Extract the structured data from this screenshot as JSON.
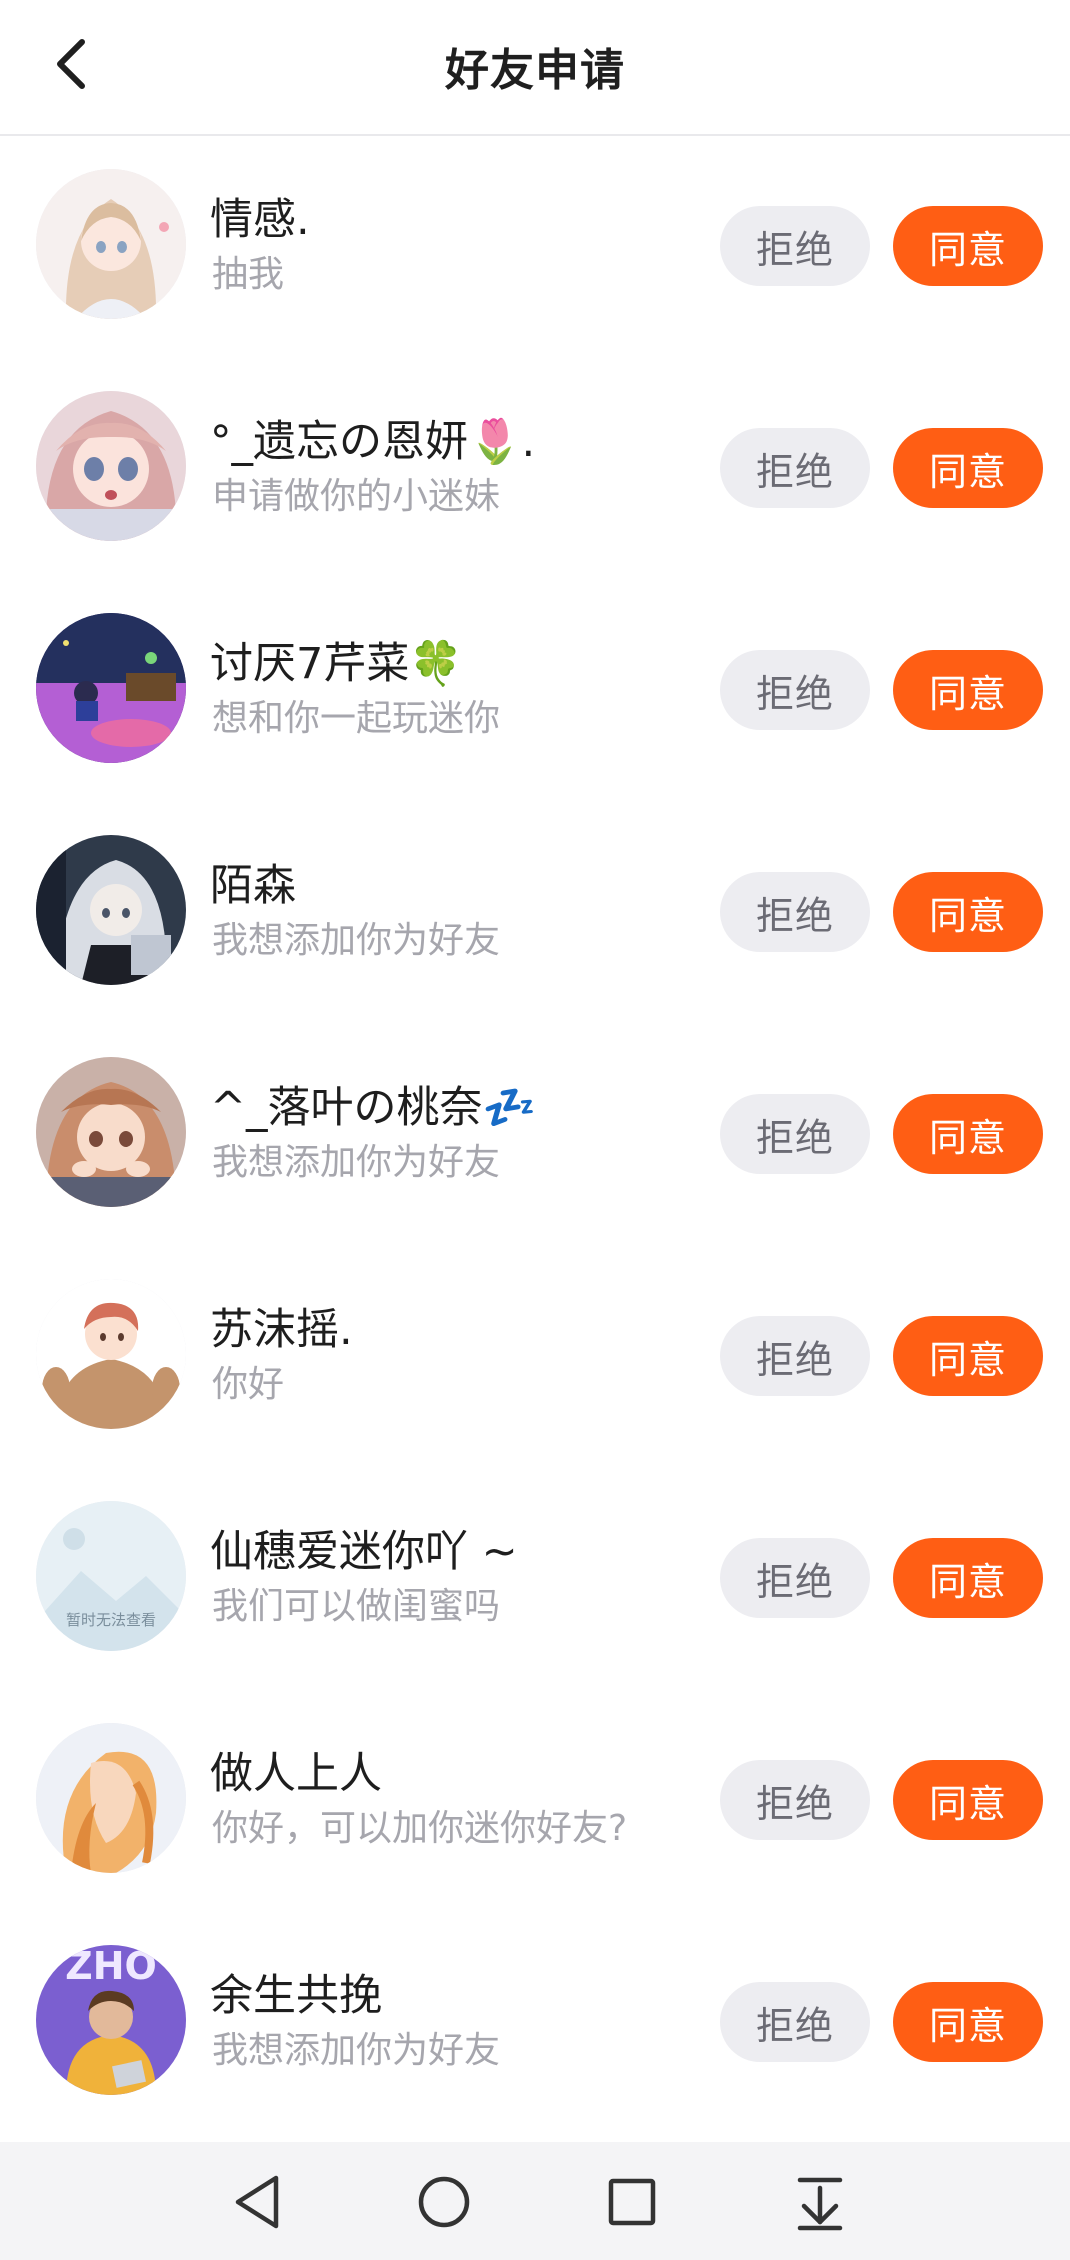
{
  "header": {
    "title": "好友申请",
    "back_icon": "chevron-left-icon"
  },
  "colors": {
    "accent": "#ff5e14",
    "reject_bg": "#ededf1",
    "message_text": "#a6a6ad"
  },
  "requests": [
    {
      "name": "情感.",
      "message": "抽我",
      "reject_label": "拒绝",
      "accept_label": "同意"
    },
    {
      "name": "°_遗忘の恩妍🌷.",
      "message": "申请做你的小迷妹",
      "reject_label": "拒绝",
      "accept_label": "同意"
    },
    {
      "name": "讨厌7芹菜🍀",
      "message": "想和你一起玩迷你",
      "reject_label": "拒绝",
      "accept_label": "同意"
    },
    {
      "name": "陌森",
      "message": "我想添加你为好友",
      "reject_label": "拒绝",
      "accept_label": "同意"
    },
    {
      "name": "^_落叶の桃奈💤",
      "message": "我想添加你为好友",
      "reject_label": "拒绝",
      "accept_label": "同意"
    },
    {
      "name": "苏沫摇.",
      "message": "你好",
      "reject_label": "拒绝",
      "accept_label": "同意"
    },
    {
      "name": "仙穗爱迷你吖 ~",
      "message": "我们可以做闺蜜吗",
      "reject_label": "拒绝",
      "accept_label": "同意",
      "avatar_placeholder_text": "暂时无法查看"
    },
    {
      "name": "做人上人",
      "message": "你好，可以加你迷你好友?",
      "reject_label": "拒绝",
      "accept_label": "同意"
    },
    {
      "name": "余生共挽",
      "message": "我想添加你为好友",
      "reject_label": "拒绝",
      "accept_label": "同意",
      "avatar_text": "ZHO"
    }
  ],
  "system_nav": {
    "back_icon": "triangle-back-icon",
    "home_icon": "circle-home-icon",
    "recents_icon": "square-recents-icon",
    "notification_icon": "pull-down-notification-icon"
  }
}
